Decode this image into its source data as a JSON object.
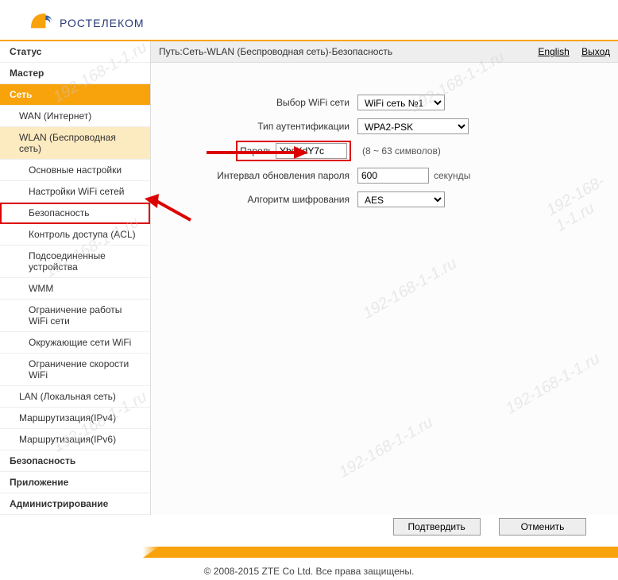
{
  "logo": {
    "text": "РОСТЕЛЕКОМ"
  },
  "sidebar": {
    "status": "Статус",
    "master": "Мастер",
    "network": "Сеть",
    "wan": "WAN (Интернет)",
    "wlan": "WLAN (Беспроводная сеть)",
    "basic": "Основные настройки",
    "wifi_settings": "Настройки WiFi сетей",
    "security": "Безопасность",
    "acl": "Контроль доступа (ACL)",
    "assoc": "Подсоединенные устройства",
    "wmm": "WMM",
    "restrict": "Ограничение работы WiFi сети",
    "surround": "Окружающие сети WiFi",
    "speed": "Ограничение скорости WiFi",
    "lan": "LAN (Локальная сеть)",
    "ipv4": "Маршрутизация(IPv4)",
    "ipv6": "Маршрутизация(IPv6)",
    "sec_section": "Безопасность",
    "app": "Приложение",
    "admin": "Администрирование"
  },
  "breadcrumb": {
    "label": "Путь:Сеть-WLAN (Беспроводная сеть)-Безопасность",
    "english": "English",
    "exit": "Выход"
  },
  "form": {
    "ssid_label": "Выбор WiFi сети",
    "ssid_value": "WiFi сеть №1",
    "auth_label": "Тип аутентификации",
    "auth_value": "WPA2-PSK",
    "pass_label": "Пароль",
    "pass_value": "YhsKdY7c",
    "pass_hint": "(8 ~ 63 символов)",
    "interval_label": "Интервал обновления пароля",
    "interval_value": "600",
    "interval_unit": "секунды",
    "enc_label": "Алгоритм шифрования",
    "enc_value": "AES"
  },
  "buttons": {
    "submit": "Подтвердить",
    "cancel": "Отменить"
  },
  "footer": {
    "copyright": "© 2008-2015 ZTE Co Ltd. Все права защищены."
  },
  "watermark": "192-168-1-1.ru"
}
